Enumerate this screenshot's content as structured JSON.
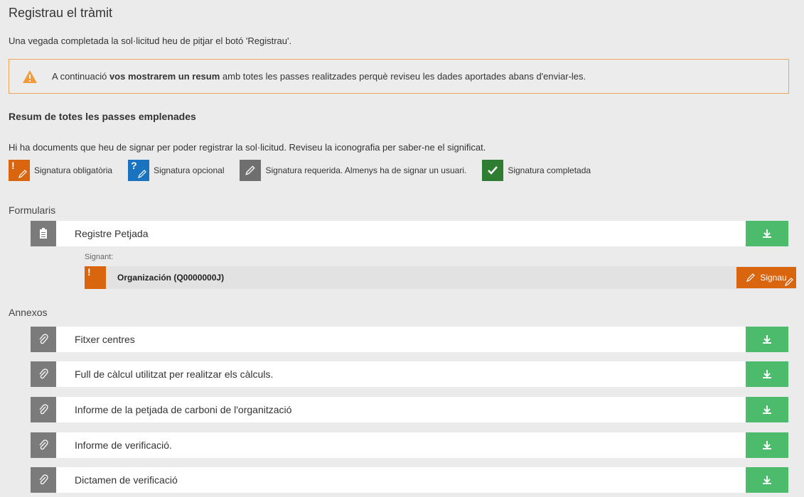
{
  "page": {
    "title": "Registrau el tràmit",
    "intro": "Una vegada completada la sol·licitud heu de pitjar el botó 'Registrau'."
  },
  "alert": {
    "icon": "warning-icon",
    "text_before": "A continuació ",
    "text_bold": "vos mostrarem un resum",
    "text_after": " amb totes les passes realitzades perquè reviseu les dades aportades abans d'enviar-les.",
    "border_color": "#f0a35a"
  },
  "summary": {
    "title": "Resum de totes les passes emplenades",
    "hint": "Hi ha documents que heu de signar per poder registrar la sol·licitud. Reviseu la iconografia per saber-ne el significat."
  },
  "legend": [
    {
      "label": "Signatura obligatòria",
      "color": "#d9650f",
      "icon": "required-signature-icon"
    },
    {
      "label": "Signatura opcional",
      "color": "#1a73c1",
      "icon": "optional-signature-icon"
    },
    {
      "label": "Signatura requerida. Almenys ha de signar un usuari.",
      "color": "#6f6f6f",
      "icon": "pen-icon"
    },
    {
      "label": "Signatura completada",
      "color": "#2e7d32",
      "icon": "check-icon"
    }
  ],
  "forms": {
    "label": "Formularis",
    "items": [
      {
        "label": "Registre Petjada",
        "icon": "clipboard-icon",
        "signant_label": "Signant:",
        "signer": "Organización (Q0000000J)",
        "sign_button": "Signau"
      }
    ]
  },
  "annexes": {
    "label": "Annexos",
    "items": [
      {
        "label": "Fitxer centres",
        "icon": "paperclip-icon"
      },
      {
        "label": "Full de càlcul utilitzat per realitzar els càlculs.",
        "icon": "paperclip-icon"
      },
      {
        "label": "Informe de la petjada de carboni de l'organització",
        "icon": "paperclip-icon"
      },
      {
        "label": "Informe de verificació.",
        "icon": "paperclip-icon"
      },
      {
        "label": "Dictamen de verificació",
        "icon": "paperclip-icon"
      }
    ]
  },
  "colors": {
    "download": "#4cbb6c",
    "icon_bg": "#7b7b7b",
    "sign": "#d9650f"
  }
}
